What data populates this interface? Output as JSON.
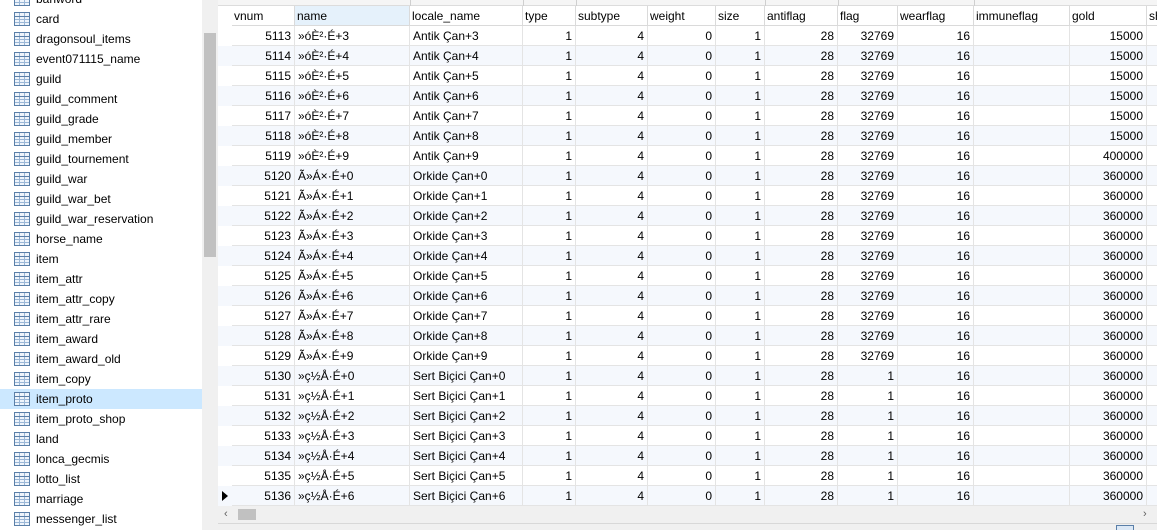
{
  "sidebar": {
    "items": [
      {
        "label": "banword"
      },
      {
        "label": "card"
      },
      {
        "label": "dragonsoul_items"
      },
      {
        "label": "event071115_name"
      },
      {
        "label": "guild"
      },
      {
        "label": "guild_comment"
      },
      {
        "label": "guild_grade"
      },
      {
        "label": "guild_member"
      },
      {
        "label": "guild_tournement"
      },
      {
        "label": "guild_war"
      },
      {
        "label": "guild_war_bet"
      },
      {
        "label": "guild_war_reservation"
      },
      {
        "label": "horse_name"
      },
      {
        "label": "item"
      },
      {
        "label": "item_attr"
      },
      {
        "label": "item_attr_copy"
      },
      {
        "label": "item_attr_rare"
      },
      {
        "label": "item_award"
      },
      {
        "label": "item_award_old"
      },
      {
        "label": "item_copy"
      },
      {
        "label": "item_proto"
      },
      {
        "label": "item_proto_shop"
      },
      {
        "label": "land"
      },
      {
        "label": "lonca_gecmis"
      },
      {
        "label": "lotto_list"
      },
      {
        "label": "marriage"
      },
      {
        "label": "messenger_list"
      }
    ],
    "selected_index": 20,
    "item_icon": "table-icon"
  },
  "grid": {
    "columns": [
      "vnum",
      "name",
      "locale_name",
      "type",
      "subtype",
      "weight",
      "size",
      "antiflag",
      "flag",
      "wearflag",
      "immuneflag",
      "gold",
      "sh"
    ],
    "sorted_column": "name",
    "rows": [
      [
        "5113",
        "»óÈ²·É+3",
        "Antik Çan+3",
        "1",
        "4",
        "0",
        "1",
        "28",
        "32769",
        "16",
        "",
        "15000"
      ],
      [
        "5114",
        "»óÈ²·É+4",
        "Antik Çan+4",
        "1",
        "4",
        "0",
        "1",
        "28",
        "32769",
        "16",
        "",
        "15000"
      ],
      [
        "5115",
        "»óÈ²·É+5",
        "Antik Çan+5",
        "1",
        "4",
        "0",
        "1",
        "28",
        "32769",
        "16",
        "",
        "15000"
      ],
      [
        "5116",
        "»óÈ²·É+6",
        "Antik Çan+6",
        "1",
        "4",
        "0",
        "1",
        "28",
        "32769",
        "16",
        "",
        "15000"
      ],
      [
        "5117",
        "»óÈ²·É+7",
        "Antik Çan+7",
        "1",
        "4",
        "0",
        "1",
        "28",
        "32769",
        "16",
        "",
        "15000"
      ],
      [
        "5118",
        "»óÈ²·É+8",
        "Antik Çan+8",
        "1",
        "4",
        "0",
        "1",
        "28",
        "32769",
        "16",
        "",
        "15000"
      ],
      [
        "5119",
        "»óÈ²·É+9",
        "Antik Çan+9",
        "1",
        "4",
        "0",
        "1",
        "28",
        "32769",
        "16",
        "",
        "400000"
      ],
      [
        "5120",
        "Ã»Á×·É+0",
        "Orkide Çan+0",
        "1",
        "4",
        "0",
        "1",
        "28",
        "32769",
        "16",
        "",
        "360000"
      ],
      [
        "5121",
        "Ã»Á×·É+1",
        "Orkide Çan+1",
        "1",
        "4",
        "0",
        "1",
        "28",
        "32769",
        "16",
        "",
        "360000"
      ],
      [
        "5122",
        "Ã»Á×·É+2",
        "Orkide Çan+2",
        "1",
        "4",
        "0",
        "1",
        "28",
        "32769",
        "16",
        "",
        "360000"
      ],
      [
        "5123",
        "Ã»Á×·É+3",
        "Orkide Çan+3",
        "1",
        "4",
        "0",
        "1",
        "28",
        "32769",
        "16",
        "",
        "360000"
      ],
      [
        "5124",
        "Ã»Á×·É+4",
        "Orkide Çan+4",
        "1",
        "4",
        "0",
        "1",
        "28",
        "32769",
        "16",
        "",
        "360000"
      ],
      [
        "5125",
        "Ã»Á×·É+5",
        "Orkide Çan+5",
        "1",
        "4",
        "0",
        "1",
        "28",
        "32769",
        "16",
        "",
        "360000"
      ],
      [
        "5126",
        "Ã»Á×·É+6",
        "Orkide Çan+6",
        "1",
        "4",
        "0",
        "1",
        "28",
        "32769",
        "16",
        "",
        "360000"
      ],
      [
        "5127",
        "Ã»Á×·É+7",
        "Orkide Çan+7",
        "1",
        "4",
        "0",
        "1",
        "28",
        "32769",
        "16",
        "",
        "360000"
      ],
      [
        "5128",
        "Ã»Á×·É+8",
        "Orkide Çan+8",
        "1",
        "4",
        "0",
        "1",
        "28",
        "32769",
        "16",
        "",
        "360000"
      ],
      [
        "5129",
        "Ã»Á×·É+9",
        "Orkide Çan+9",
        "1",
        "4",
        "0",
        "1",
        "28",
        "32769",
        "16",
        "",
        "360000"
      ],
      [
        "5130",
        "»ç½Å·É+0",
        "Sert Biçici Çan+0",
        "1",
        "4",
        "0",
        "1",
        "28",
        "1",
        "16",
        "",
        "360000"
      ],
      [
        "5131",
        "»ç½Å·É+1",
        "Sert Biçici Çan+1",
        "1",
        "4",
        "0",
        "1",
        "28",
        "1",
        "16",
        "",
        "360000"
      ],
      [
        "5132",
        "»ç½Å·É+2",
        "Sert Biçici Çan+2",
        "1",
        "4",
        "0",
        "1",
        "28",
        "1",
        "16",
        "",
        "360000"
      ],
      [
        "5133",
        "»ç½Å·É+3",
        "Sert Biçici Çan+3",
        "1",
        "4",
        "0",
        "1",
        "28",
        "1",
        "16",
        "",
        "360000"
      ],
      [
        "5134",
        "»ç½Å·É+4",
        "Sert Biçici Çan+4",
        "1",
        "4",
        "0",
        "1",
        "28",
        "1",
        "16",
        "",
        "360000"
      ],
      [
        "5135",
        "»ç½Å·É+5",
        "Sert Biçici Çan+5",
        "1",
        "4",
        "0",
        "1",
        "28",
        "1",
        "16",
        "",
        "360000"
      ],
      [
        "5136",
        "»ç½Å·É+6",
        "Sert Biçici Çan+6",
        "1",
        "4",
        "0",
        "1",
        "28",
        "1",
        "16",
        "",
        "360000"
      ]
    ],
    "current_row_index": 23,
    "current_row_marker_icon": "row-pointer-icon"
  },
  "scrollbars": {
    "left_arrow": "‹",
    "right_arrow": "›"
  },
  "colors": {
    "selected_item_bg": "#cce8ff",
    "sorted_header_bg": "#e5f1fb",
    "alt_row_bg": "#f5f8fd"
  }
}
